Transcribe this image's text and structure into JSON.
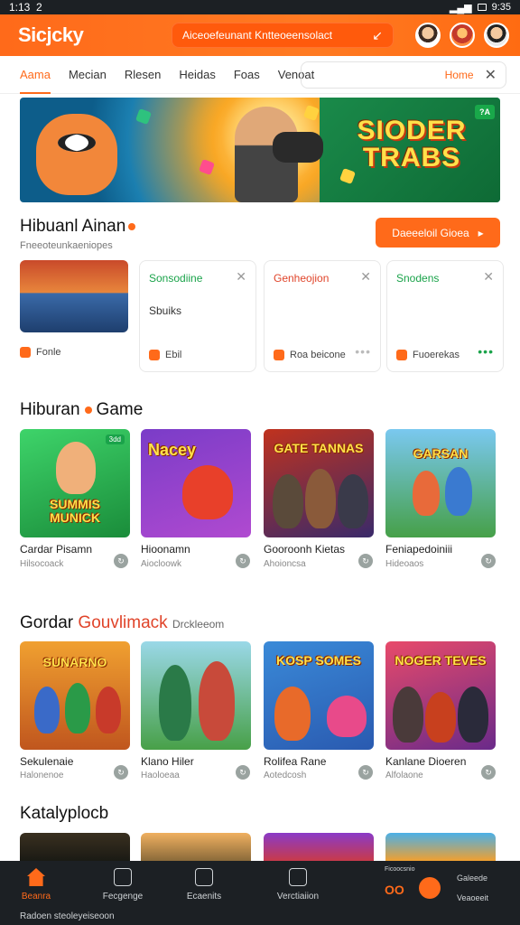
{
  "status": {
    "time": "1:13",
    "num": "2",
    "right": "9:35"
  },
  "appbar": {
    "logo": "Sicjcky",
    "search": "Aiceoefeunant Kntteoeensolact",
    "search_icon": "arrow-icon"
  },
  "tabs": [
    "Aama",
    "Mecian",
    "Rlesen",
    "Heidas",
    "Foas",
    "Venoat"
  ],
  "tab_search": {
    "placeholder": "Home"
  },
  "banner": {
    "title": "SIODER TRABS",
    "badge": "?A"
  },
  "section1": {
    "title": "Hibuanl Ainan",
    "subtitle": "Fneeoteunkaeniopes",
    "cta": "Daeeeloil Gioea"
  },
  "row1": [
    {
      "kind": "thumb",
      "foot": "Fonle"
    },
    {
      "kind": "card",
      "head": "Sonsodiine",
      "head_color": "#1aa34a",
      "mid": "Sbuiks",
      "foot": "Ebil"
    },
    {
      "kind": "card",
      "head": "Genheojion",
      "head_color": "#e0442a",
      "foot": "Roa beicone"
    },
    {
      "kind": "card",
      "head": "Snodens",
      "head_color": "#1aa34a",
      "foot": "Fuoerekas"
    }
  ],
  "section2": {
    "title": "Hiburan",
    "title_tail": "Game"
  },
  "tiles2": [
    {
      "label": "SUMMIS MUNICK",
      "tag": "3dd",
      "name": "Cardar Pisamn",
      "meta": "Hilsocoack"
    },
    {
      "label": "Nacey",
      "tag": "",
      "name": "Hioonamn",
      "meta": "Aiocloowk"
    },
    {
      "label": "GATE TANNAS",
      "tag": "",
      "name": "Gooroonh Kietas",
      "meta": "Ahoioncsa"
    },
    {
      "label": "GARSAN",
      "tag": "",
      "name": "Feniapedoiniii",
      "meta": "Hideoaos"
    }
  ],
  "section3": {
    "title_a": "Gordar",
    "title_b": "Gouvlimack",
    "title_c": "Drckleeom"
  },
  "tiles3": [
    {
      "label": "SUNARNO",
      "name": "Sekulenaie",
      "meta": "Halonenoe"
    },
    {
      "label": "",
      "name": "Klano Hiler",
      "meta": "Haoloeaa"
    },
    {
      "label": "KOSP SOMES",
      "name": "Rolifea Rane",
      "meta": "Aotedcosh"
    },
    {
      "label": "NOGER TEVES",
      "name": "Kanlane Dioeren",
      "meta": "Alfolaone"
    }
  ],
  "section4": {
    "title": "Katalyplocb"
  },
  "bottomnav": {
    "items": [
      {
        "label": "Beanra",
        "icon": "home-icon",
        "active": true
      },
      {
        "label": "Fecgenge",
        "icon": "chart-icon",
        "active": false
      },
      {
        "label": "Ecaenits",
        "icon": "doc-icon",
        "active": false
      },
      {
        "label": "Verctiaiion",
        "icon": "edit-icon",
        "active": false
      }
    ],
    "promo_small": "Ficoocsnio",
    "promo_text_a": "Galeede",
    "promo_text_b": "Veaoeeit",
    "promo_oo": "OO",
    "footer": "Radoen steoleyeiseoon"
  },
  "colors": {
    "accent": "#ff6a1a",
    "green": "#1aa34a",
    "dark": "#1c2024"
  }
}
